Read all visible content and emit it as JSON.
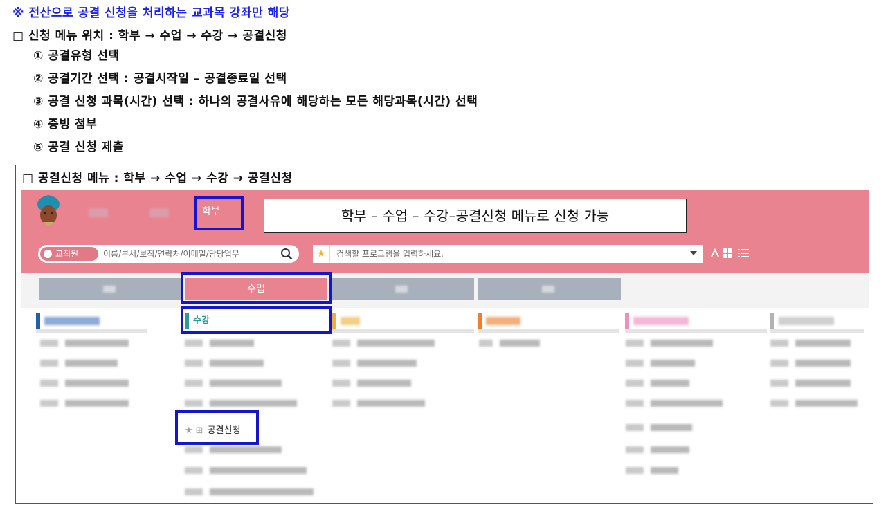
{
  "notice": "※ 전산으로 공결 신청을 처리하는 교과목 강좌만 해당",
  "path_line": "□ 신청 메뉴 위치 : 학부 → 수업 → 수강 → 공결신청",
  "steps": [
    "① 공결유형 선택",
    "② 공결기간 선택 : 공결시작일 – 공결종료일 선택",
    "③ 공결 신청 과목(시간) 선택 : 하나의 공결사유에 해당하는 모든 해당과목(시간) 선택",
    "④ 증빙 첨부",
    "⑤ 공결 신청 제출"
  ],
  "frame_title": "□ 공결신청 메뉴 : 학부 → 수업 → 수강 → 공결신청",
  "screenshot": {
    "top_menu": {
      "hakbu": "학부"
    },
    "banner": "학부 – 수업 – 수강–공결신청 메뉴로 신청 가능",
    "search": {
      "scope": "교직원",
      "placeholder": "이름/부서/보직/연락처/이메일/담당업무",
      "program_placeholder": "검색할 프로그램을 입력하세요."
    },
    "tabs": {
      "active": "수업"
    },
    "columns": {
      "sugang": "수강"
    },
    "apply_item": "공결신청"
  },
  "colors": {
    "header_pink": "#e9838f",
    "highlight_blue": "#1515d0",
    "notice_blue": "#1b22e6",
    "tab_gray": "#a8b1bb",
    "sugang_teal": "#2a9a96"
  },
  "icons": [
    "logo-icon",
    "search-icon",
    "star-icon",
    "dropdown-caret-icon",
    "grid-view-icon",
    "list-view-icon",
    "favorite-star-icon",
    "grid-small-icon"
  ]
}
